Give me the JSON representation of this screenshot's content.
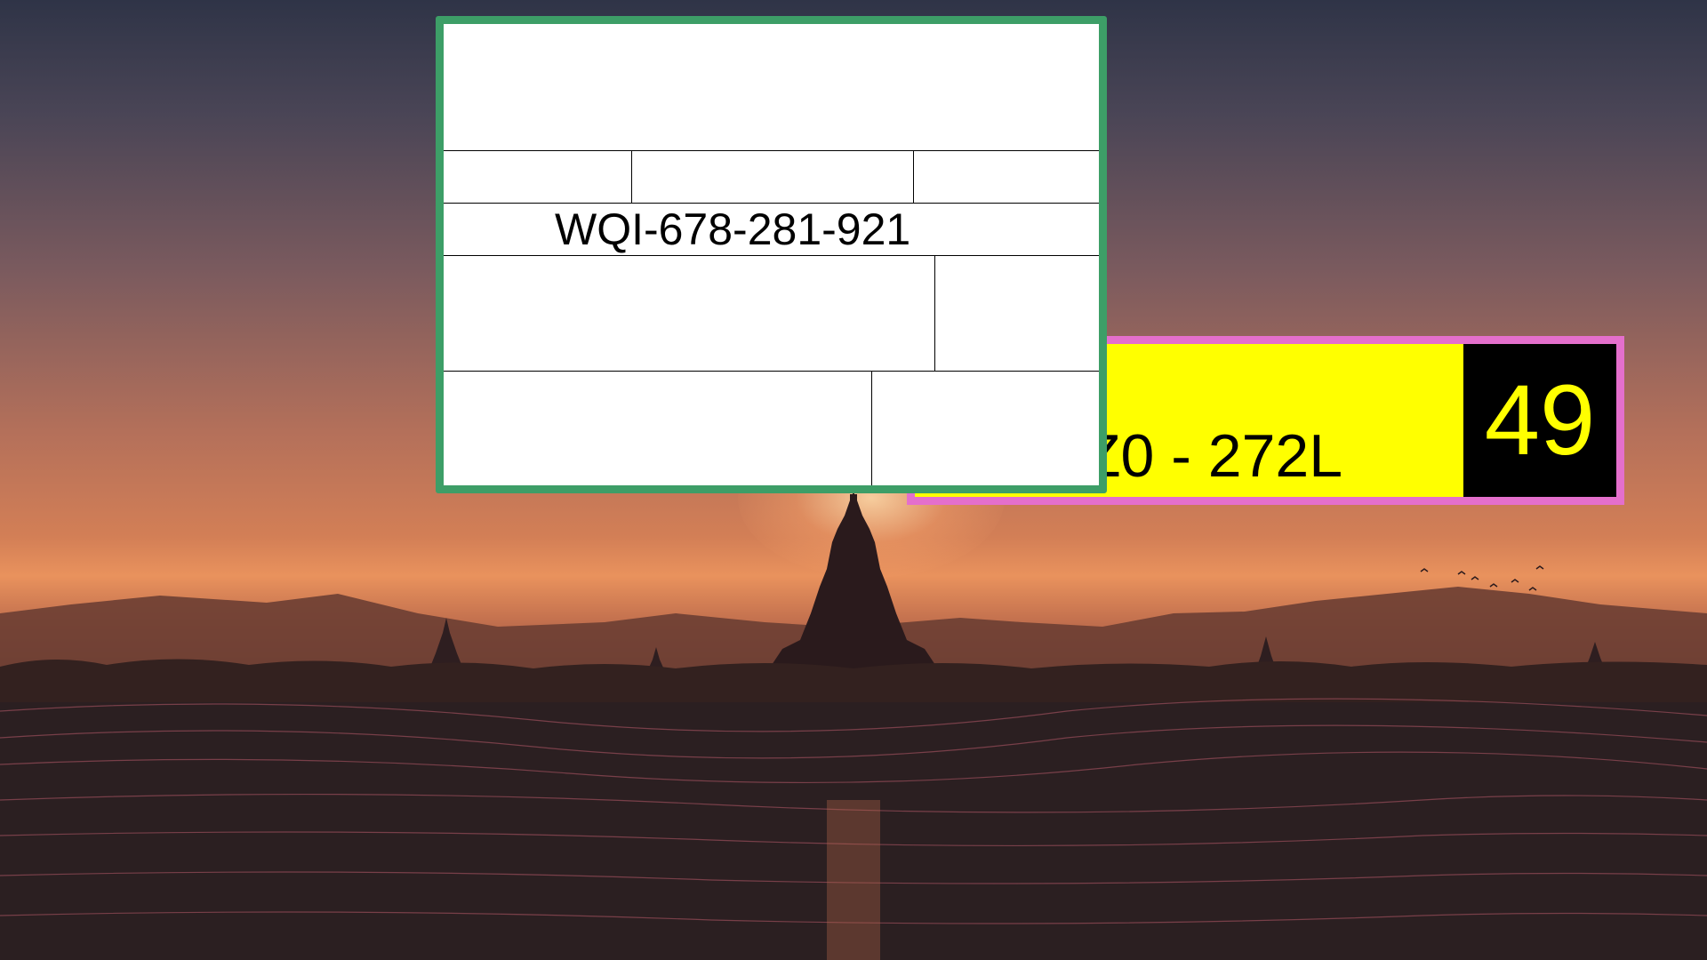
{
  "form": {
    "id_code": "WQI-678-281-921"
  },
  "sign": {
    "code": "Z0 - 272L",
    "number": "49"
  },
  "colors": {
    "form_border": "#3d9e67",
    "sign_border": "#e46fcc",
    "sign_background": "#ffff00",
    "number_box": "#000000",
    "number_text": "#ffff00"
  }
}
